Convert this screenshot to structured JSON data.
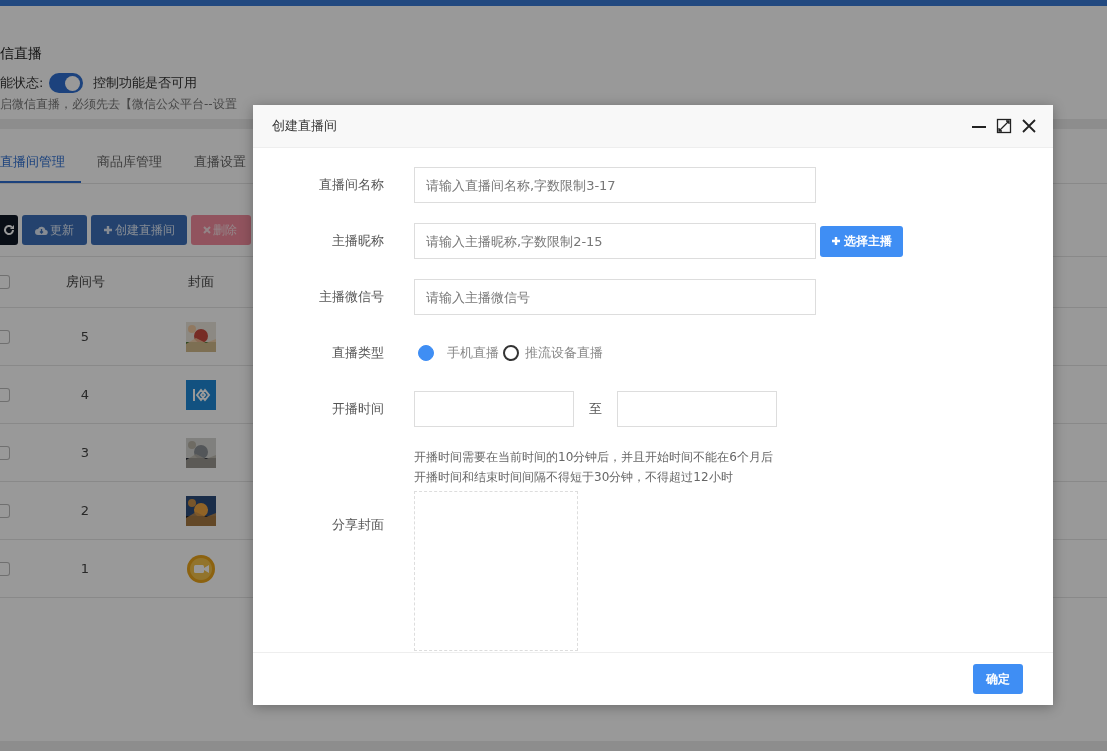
{
  "page": {
    "title": "信直播",
    "status_label": "能状态:",
    "status_toggle": {
      "on": true
    },
    "status_hint": "控制功能是否可用",
    "notice": "启微信直播，必须先去【微信公众平台--设置"
  },
  "tabs": [
    {
      "label": "直播间管理",
      "selected": true
    },
    {
      "label": "商品库管理",
      "selected": false
    },
    {
      "label": "直播设置",
      "selected": false
    }
  ],
  "toolbar": [
    {
      "kind": "refresh"
    },
    {
      "kind": "update",
      "label": "更新"
    },
    {
      "kind": "create",
      "label": "创建直播间"
    },
    {
      "kind": "delete",
      "label": "删除"
    }
  ],
  "table": {
    "select_all": {
      "checked": false
    },
    "columns": [
      "房间号",
      "封面"
    ],
    "rows": [
      {
        "checked": false,
        "room": "5"
      },
      {
        "checked": false,
        "room": "4",
        "cover": {
          "kind": "logo"
        }
      },
      {
        "checked": false,
        "room": "3"
      },
      {
        "checked": false,
        "room": "2"
      },
      {
        "checked": false,
        "room": "1",
        "cover": {
          "kind": "camera"
        }
      }
    ]
  },
  "dialog": {
    "title": "创建直播间",
    "fields": [
      {
        "kind": "text",
        "label": "直播间名称",
        "placeholder": "请输入直播间名称,字数限制3-17"
      },
      {
        "kind": "text",
        "label": "主播昵称",
        "placeholder": "请输入主播昵称,字数限制2-15",
        "button": "选择主播"
      },
      {
        "kind": "text",
        "label": "主播微信号",
        "placeholder": "请输入主播微信号"
      },
      {
        "kind": "radio",
        "label": "直播类型",
        "options": [
          {
            "label": "手机直播",
            "selected": true
          },
          {
            "label": "推流设备直播",
            "selected": false
          }
        ]
      },
      {
        "kind": "daterange",
        "label": "开播时间",
        "separator": "至",
        "hints": [
          "开播时间需要在当前时间的10分钟后，并且开始时间不能在6个月后",
          "开播时间和结束时间间隔不得短于30分钟，不得超过12小时"
        ]
      },
      {
        "kind": "upload",
        "label": "分享封面"
      }
    ],
    "confirm": "确定"
  }
}
